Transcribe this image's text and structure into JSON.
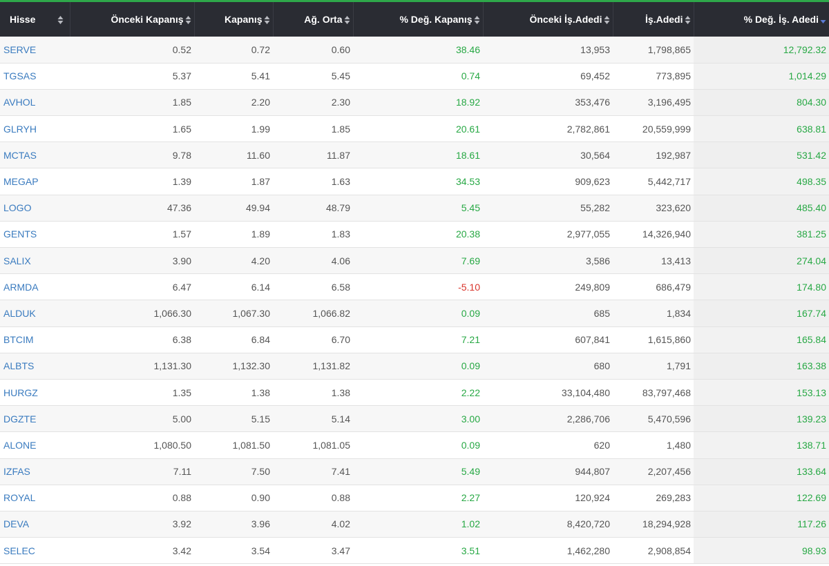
{
  "table": {
    "columns": [
      {
        "label": "Hisse"
      },
      {
        "label": "Önceki Kapanış"
      },
      {
        "label": "Kapanış"
      },
      {
        "label": "Ağ. Orta"
      },
      {
        "label": "% Değ. Kapanış"
      },
      {
        "label": "Önceki İş.Adedi"
      },
      {
        "label": "İş.Adedi"
      },
      {
        "label": "% Değ. İş. Adedi"
      }
    ],
    "sorted_column": "% Değ. İş. Adedi",
    "sort_direction": "descending",
    "rows": [
      {
        "symbol": "SERVE",
        "prev_close": "0.52",
        "close": "0.72",
        "wavg": "0.60",
        "chg_close": "38.46",
        "prev_vol": "13,953",
        "vol": "1,798,865",
        "chg_vol": "12,792.32"
      },
      {
        "symbol": "TGSAS",
        "prev_close": "5.37",
        "close": "5.41",
        "wavg": "5.45",
        "chg_close": "0.74",
        "prev_vol": "69,452",
        "vol": "773,895",
        "chg_vol": "1,014.29"
      },
      {
        "symbol": "AVHOL",
        "prev_close": "1.85",
        "close": "2.20",
        "wavg": "2.30",
        "chg_close": "18.92",
        "prev_vol": "353,476",
        "vol": "3,196,495",
        "chg_vol": "804.30"
      },
      {
        "symbol": "GLRYH",
        "prev_close": "1.65",
        "close": "1.99",
        "wavg": "1.85",
        "chg_close": "20.61",
        "prev_vol": "2,782,861",
        "vol": "20,559,999",
        "chg_vol": "638.81"
      },
      {
        "symbol": "MCTAS",
        "prev_close": "9.78",
        "close": "11.60",
        "wavg": "11.87",
        "chg_close": "18.61",
        "prev_vol": "30,564",
        "vol": "192,987",
        "chg_vol": "531.42"
      },
      {
        "symbol": "MEGAP",
        "prev_close": "1.39",
        "close": "1.87",
        "wavg": "1.63",
        "chg_close": "34.53",
        "prev_vol": "909,623",
        "vol": "5,442,717",
        "chg_vol": "498.35"
      },
      {
        "symbol": "LOGO",
        "prev_close": "47.36",
        "close": "49.94",
        "wavg": "48.79",
        "chg_close": "5.45",
        "prev_vol": "55,282",
        "vol": "323,620",
        "chg_vol": "485.40"
      },
      {
        "symbol": "GENTS",
        "prev_close": "1.57",
        "close": "1.89",
        "wavg": "1.83",
        "chg_close": "20.38",
        "prev_vol": "2,977,055",
        "vol": "14,326,940",
        "chg_vol": "381.25"
      },
      {
        "symbol": "SALIX",
        "prev_close": "3.90",
        "close": "4.20",
        "wavg": "4.06",
        "chg_close": "7.69",
        "prev_vol": "3,586",
        "vol": "13,413",
        "chg_vol": "274.04"
      },
      {
        "symbol": "ARMDA",
        "prev_close": "6.47",
        "close": "6.14",
        "wavg": "6.58",
        "chg_close": "-5.10",
        "prev_vol": "249,809",
        "vol": "686,479",
        "chg_vol": "174.80"
      },
      {
        "symbol": "ALDUK",
        "prev_close": "1,066.30",
        "close": "1,067.30",
        "wavg": "1,066.82",
        "chg_close": "0.09",
        "prev_vol": "685",
        "vol": "1,834",
        "chg_vol": "167.74"
      },
      {
        "symbol": "BTCIM",
        "prev_close": "6.38",
        "close": "6.84",
        "wavg": "6.70",
        "chg_close": "7.21",
        "prev_vol": "607,841",
        "vol": "1,615,860",
        "chg_vol": "165.84"
      },
      {
        "symbol": "ALBTS",
        "prev_close": "1,131.30",
        "close": "1,132.30",
        "wavg": "1,131.82",
        "chg_close": "0.09",
        "prev_vol": "680",
        "vol": "1,791",
        "chg_vol": "163.38"
      },
      {
        "symbol": "HURGZ",
        "prev_close": "1.35",
        "close": "1.38",
        "wavg": "1.38",
        "chg_close": "2.22",
        "prev_vol": "33,104,480",
        "vol": "83,797,468",
        "chg_vol": "153.13"
      },
      {
        "symbol": "DGZTE",
        "prev_close": "5.00",
        "close": "5.15",
        "wavg": "5.14",
        "chg_close": "3.00",
        "prev_vol": "2,286,706",
        "vol": "5,470,596",
        "chg_vol": "139.23"
      },
      {
        "symbol": "ALONE",
        "prev_close": "1,080.50",
        "close": "1,081.50",
        "wavg": "1,081.05",
        "chg_close": "0.09",
        "prev_vol": "620",
        "vol": "1,480",
        "chg_vol": "138.71"
      },
      {
        "symbol": "IZFAS",
        "prev_close": "7.11",
        "close": "7.50",
        "wavg": "7.41",
        "chg_close": "5.49",
        "prev_vol": "944,807",
        "vol": "2,207,456",
        "chg_vol": "133.64"
      },
      {
        "symbol": "ROYAL",
        "prev_close": "0.88",
        "close": "0.90",
        "wavg": "0.88",
        "chg_close": "2.27",
        "prev_vol": "120,924",
        "vol": "269,283",
        "chg_vol": "122.69"
      },
      {
        "symbol": "DEVA",
        "prev_close": "3.92",
        "close": "3.96",
        "wavg": "4.02",
        "chg_close": "1.02",
        "prev_vol": "8,420,720",
        "vol": "18,294,928",
        "chg_vol": "117.26"
      },
      {
        "symbol": "SELEC",
        "prev_close": "3.42",
        "close": "3.54",
        "wavg": "3.47",
        "chg_close": "3.51",
        "prev_vol": "1,462,280",
        "vol": "2,908,854",
        "chg_vol": "98.93"
      }
    ]
  },
  "colors": {
    "header_bg": "#2a2c33",
    "accent_line": "#2ea84a",
    "link": "#3a7bbf",
    "positive": "#27a844",
    "negative": "#d9342b",
    "sort_active": "#5b7bd5"
  },
  "icons": {
    "sort": "sort-updown-icon",
    "sort_active": "sort-desc-icon"
  }
}
